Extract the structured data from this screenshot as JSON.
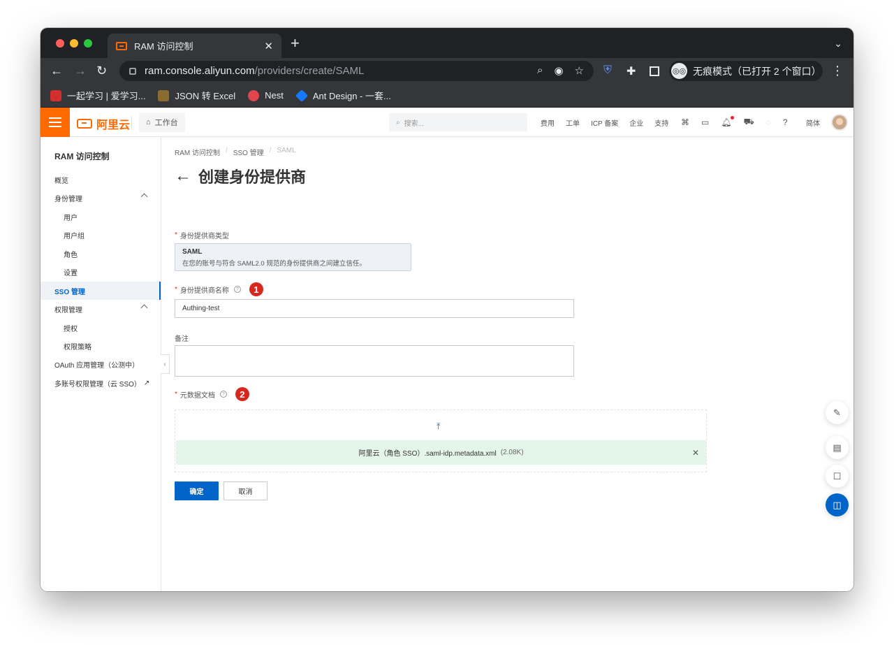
{
  "browser": {
    "tab_title": "RAM 访问控制",
    "url_host": "ram.console.aliyun.com",
    "url_path": "/providers/create/SAML",
    "incognito_label": "无痕模式（已打开 2 个窗口）",
    "bookmarks": [
      "一起学习 | 爱学习...",
      "JSON 转 Excel",
      "Nest",
      "Ant Design - 一套..."
    ],
    "colors": {
      "bookmark_icons": [
        "#d32f2f",
        "#8b6b2e",
        "#e0454f",
        "#1677ff"
      ]
    }
  },
  "topbar": {
    "brand": "阿里云",
    "workbench": "工作台",
    "search_placeholder": "搜索...",
    "nav": [
      "费用",
      "工单",
      "ICP 备案",
      "企业",
      "支持"
    ],
    "lang": "简体"
  },
  "sidebar": {
    "title": "RAM 访问控制",
    "items": [
      {
        "label": "概览"
      },
      {
        "label": "身份管理"
      },
      {
        "label": "用户"
      },
      {
        "label": "用户组"
      },
      {
        "label": "角色"
      },
      {
        "label": "设置"
      },
      {
        "label": "SSO 管理"
      },
      {
        "label": "权限管理"
      },
      {
        "label": "授权"
      },
      {
        "label": "权限策略"
      },
      {
        "label": "OAuth 应用管理（公测中）"
      },
      {
        "label": "多账号权限管理（云 SSO）"
      }
    ]
  },
  "main": {
    "breadcrumb": [
      "RAM 访问控制",
      "SSO 管理",
      "SAML"
    ],
    "title": "创建身份提供商",
    "type_label": "身份提供商类型",
    "type_name": "SAML",
    "type_desc": "在您的账号与符合 SAML2.0 规范的身份提供商之间建立信任。",
    "name_label": "身份提供商名称",
    "name_value": "Authing-test",
    "note_label": "备注",
    "metadata_label": "元数据文档",
    "file_name": "阿里云（角色 SSO）.saml-idp.metadata.xml",
    "file_size": "(2.08K)",
    "confirm": "确定",
    "cancel": "取消",
    "badges": [
      "1",
      "2"
    ]
  },
  "colors": {
    "accent": "#ff6a00",
    "primary": "#0064c8",
    "badge": "#d7281f",
    "upload_success": "#e4f5e9"
  }
}
